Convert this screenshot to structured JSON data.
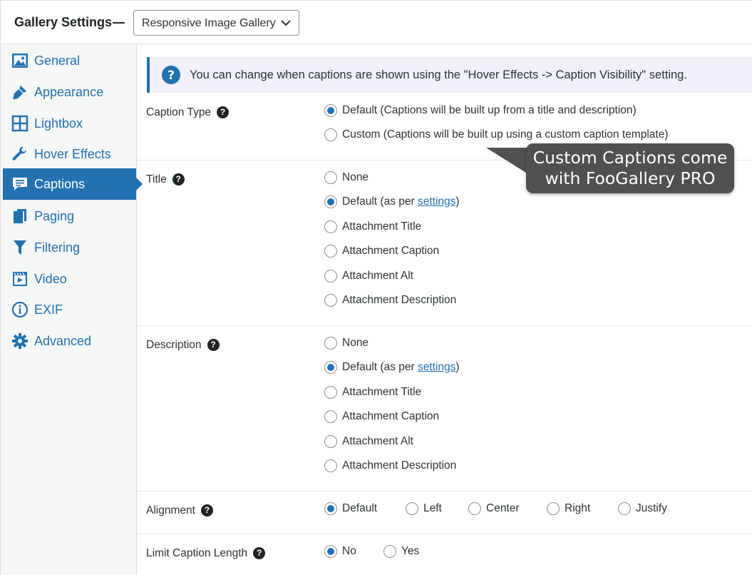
{
  "header": {
    "title": "Gallery Settings",
    "gallery_select_value": "Responsive Image Gallery"
  },
  "sidebar": {
    "items": [
      {
        "label": "General",
        "icon": "image-icon"
      },
      {
        "label": "Appearance",
        "icon": "paintbrush-icon"
      },
      {
        "label": "Lightbox",
        "icon": "grid-icon"
      },
      {
        "label": "Hover Effects",
        "icon": "wrench-icon"
      },
      {
        "label": "Captions",
        "icon": "comment-icon",
        "active": true
      },
      {
        "label": "Paging",
        "icon": "pages-icon"
      },
      {
        "label": "Filtering",
        "icon": "filter-icon"
      },
      {
        "label": "Video",
        "icon": "video-icon"
      },
      {
        "label": "EXIF",
        "icon": "info-icon"
      },
      {
        "label": "Advanced",
        "icon": "gear-icon"
      }
    ]
  },
  "notice": {
    "text": "You can change when captions are shown using the \"Hover Effects -> Caption Visibility\" setting."
  },
  "fields": {
    "caption_type": {
      "label": "Caption Type",
      "options": [
        "Default (Captions will be built up from a title and description)",
        "Custom (Captions will be built up using a custom caption template)"
      ],
      "selected": "Default (Captions will be built up from a title and description)"
    },
    "title": {
      "label": "Title",
      "options": [
        "None",
        "Default (as per",
        "Attachment Title",
        "Attachment Caption",
        "Attachment Alt",
        "Attachment Description"
      ],
      "settings_link": "settings",
      "selected": "Default (as per settings)"
    },
    "description": {
      "label": "Description",
      "options": [
        "None",
        "Default (as per",
        "Attachment Title",
        "Attachment Caption",
        "Attachment Alt",
        "Attachment Description"
      ],
      "settings_link": "settings",
      "selected": "Default (as per settings)"
    },
    "alignment": {
      "label": "Alignment",
      "options": [
        "Default",
        "Left",
        "Center",
        "Right",
        "Justify"
      ],
      "selected": "Default"
    },
    "limit_caption_length": {
      "label": "Limit Caption Length",
      "options": [
        "No",
        "Yes"
      ],
      "selected": "No"
    }
  },
  "tooltip": {
    "line1": "Custom Captions come",
    "line2": "with FooGallery PRO"
  },
  "colors": {
    "accent": "#2271b1",
    "tooltip_bg": "#505050",
    "sidebar_bg": "#f6f7f7"
  }
}
